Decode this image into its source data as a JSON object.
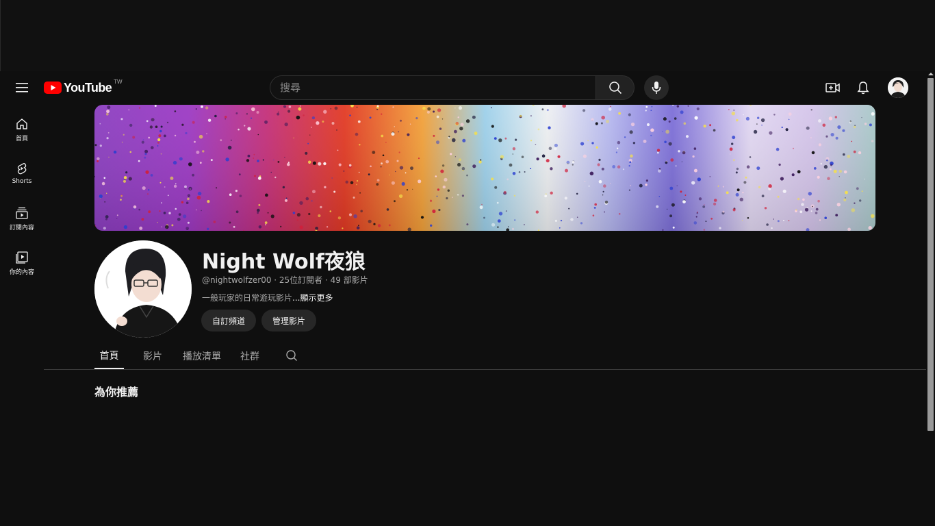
{
  "header": {
    "logo_text": "YouTube",
    "country_code": "TW",
    "search_placeholder": "搜尋"
  },
  "guide": {
    "items": [
      {
        "label": "首頁",
        "icon": "home-icon"
      },
      {
        "label": "Shorts",
        "icon": "shorts-icon"
      },
      {
        "label": "訂閱內容",
        "icon": "subscriptions-icon"
      },
      {
        "label": "你的內容",
        "icon": "your-content-icon"
      }
    ]
  },
  "channel": {
    "name": "Night Wolf夜狼",
    "meta": "@nightwolfzer00 · 25位訂閱者 · 49 部影片",
    "description": "一般玩家的日常遊玩影片",
    "more_label": "...顯示更多",
    "customize_label": "自訂頻道",
    "manage_label": "管理影片"
  },
  "tabs": [
    {
      "label": "首頁",
      "active": true
    },
    {
      "label": "影片",
      "active": false
    },
    {
      "label": "播放清單",
      "active": false
    },
    {
      "label": "社群",
      "active": false
    }
  ],
  "section": {
    "title": "為你推薦"
  },
  "colors": {
    "background": "#0f0f0f",
    "brand_red": "#ff0000",
    "text_primary": "#f1f1f1",
    "text_secondary": "#aaaaaa",
    "chip": "#272727"
  }
}
